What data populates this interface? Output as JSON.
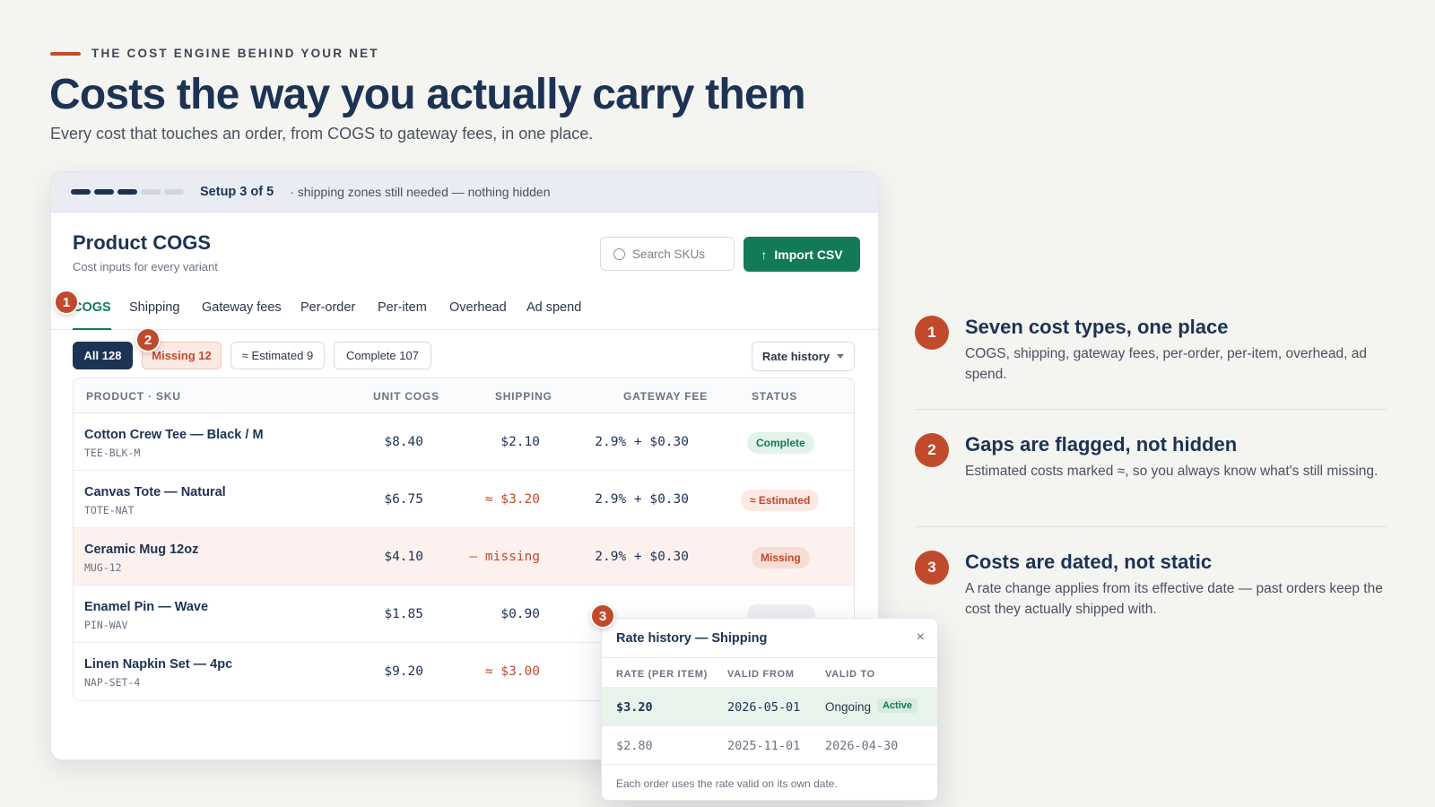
{
  "hero": {
    "eyebrow": "THE COST ENGINE BEHIND YOUR NET",
    "title": "Costs the way you actually carry them",
    "subtitle": "Every cost that touches an order, from COGS to gateway fees, in one place."
  },
  "setup": {
    "steps_total": 5,
    "steps_done": 3,
    "label": "Setup 3 of 5",
    "note": "· shipping zones still needed — nothing hidden"
  },
  "panel": {
    "title": "Product COGS",
    "subtitle": "Cost inputs for every variant",
    "search_placeholder": "Search SKUs",
    "import_label": "Import CSV",
    "import_icon": "↑",
    "tabs": [
      "COGS",
      "Shipping",
      "Gateway fees",
      "Per-order",
      "Per-item",
      "Overhead",
      "Ad spend"
    ],
    "active_tab": "COGS",
    "filters": [
      "All 128",
      "Missing 12",
      "≈ Estimated 9",
      "Complete 107"
    ],
    "rate_history_label": "Rate history"
  },
  "table": {
    "headers": [
      "PRODUCT · SKU",
      "UNIT COGS",
      "SHIPPING",
      "GATEWAY FEE",
      "STATUS"
    ],
    "rows": [
      {
        "name": "Cotton Crew Tee — Black / M",
        "sku": "TEE-BLK-M",
        "cogs": "$8.40",
        "shipping": "$2.10",
        "gateway": "2.9% + $0.30",
        "status": "Complete"
      },
      {
        "name": "Canvas Tote — Natural",
        "sku": "TOTE-NAT",
        "cogs": "$6.75",
        "shipping": "≈ $3.20",
        "gateway": "2.9% + $0.30",
        "status": "≈ Estimated"
      },
      {
        "name": "Ceramic Mug 12oz",
        "sku": "MUG-12",
        "cogs": "$4.10",
        "shipping": "— missing",
        "gateway": "2.9% + $0.30",
        "status": "Missing"
      },
      {
        "name": "Enamel Pin — Wave",
        "sku": "PIN-WAV",
        "cogs": "$1.85",
        "shipping": "$0.90",
        "gateway": "",
        "status": ""
      },
      {
        "name": "Linen Napkin Set — 4pc",
        "sku": "NAP-SET-4",
        "cogs": "$9.20",
        "shipping": "≈ $3.00",
        "gateway": "",
        "status": ""
      }
    ]
  },
  "rate_history": {
    "title": "Rate history — Shipping",
    "close": "×",
    "headers": [
      "RATE (PER ITEM)",
      "VALID FROM",
      "VALID TO"
    ],
    "rows": [
      {
        "rate": "$3.20",
        "from": "2026-05-01",
        "to": "Ongoing",
        "badge": "Active"
      },
      {
        "rate": "$2.80",
        "from": "2025-11-01",
        "to": "2026-04-30",
        "badge": ""
      }
    ],
    "footnote": "Each order uses the rate valid on its own date."
  },
  "markers": [
    "1",
    "2",
    "3"
  ],
  "features": [
    {
      "num": "1",
      "title": "Seven cost types, one place",
      "body": "COGS, shipping, gateway fees, per-order, per-item, overhead, ad spend."
    },
    {
      "num": "2",
      "title": "Gaps are flagged, not hidden",
      "body": "Estimated costs marked ≈, so you always know what's still missing."
    },
    {
      "num": "3",
      "title": "Costs are dated, not static",
      "body": "A rate change applies from its effective date — past orders keep the cost they actually shipped with."
    }
  ],
  "colors": {
    "navy": "#1c3354",
    "accent": "#c24a2c",
    "green": "#137a56"
  }
}
